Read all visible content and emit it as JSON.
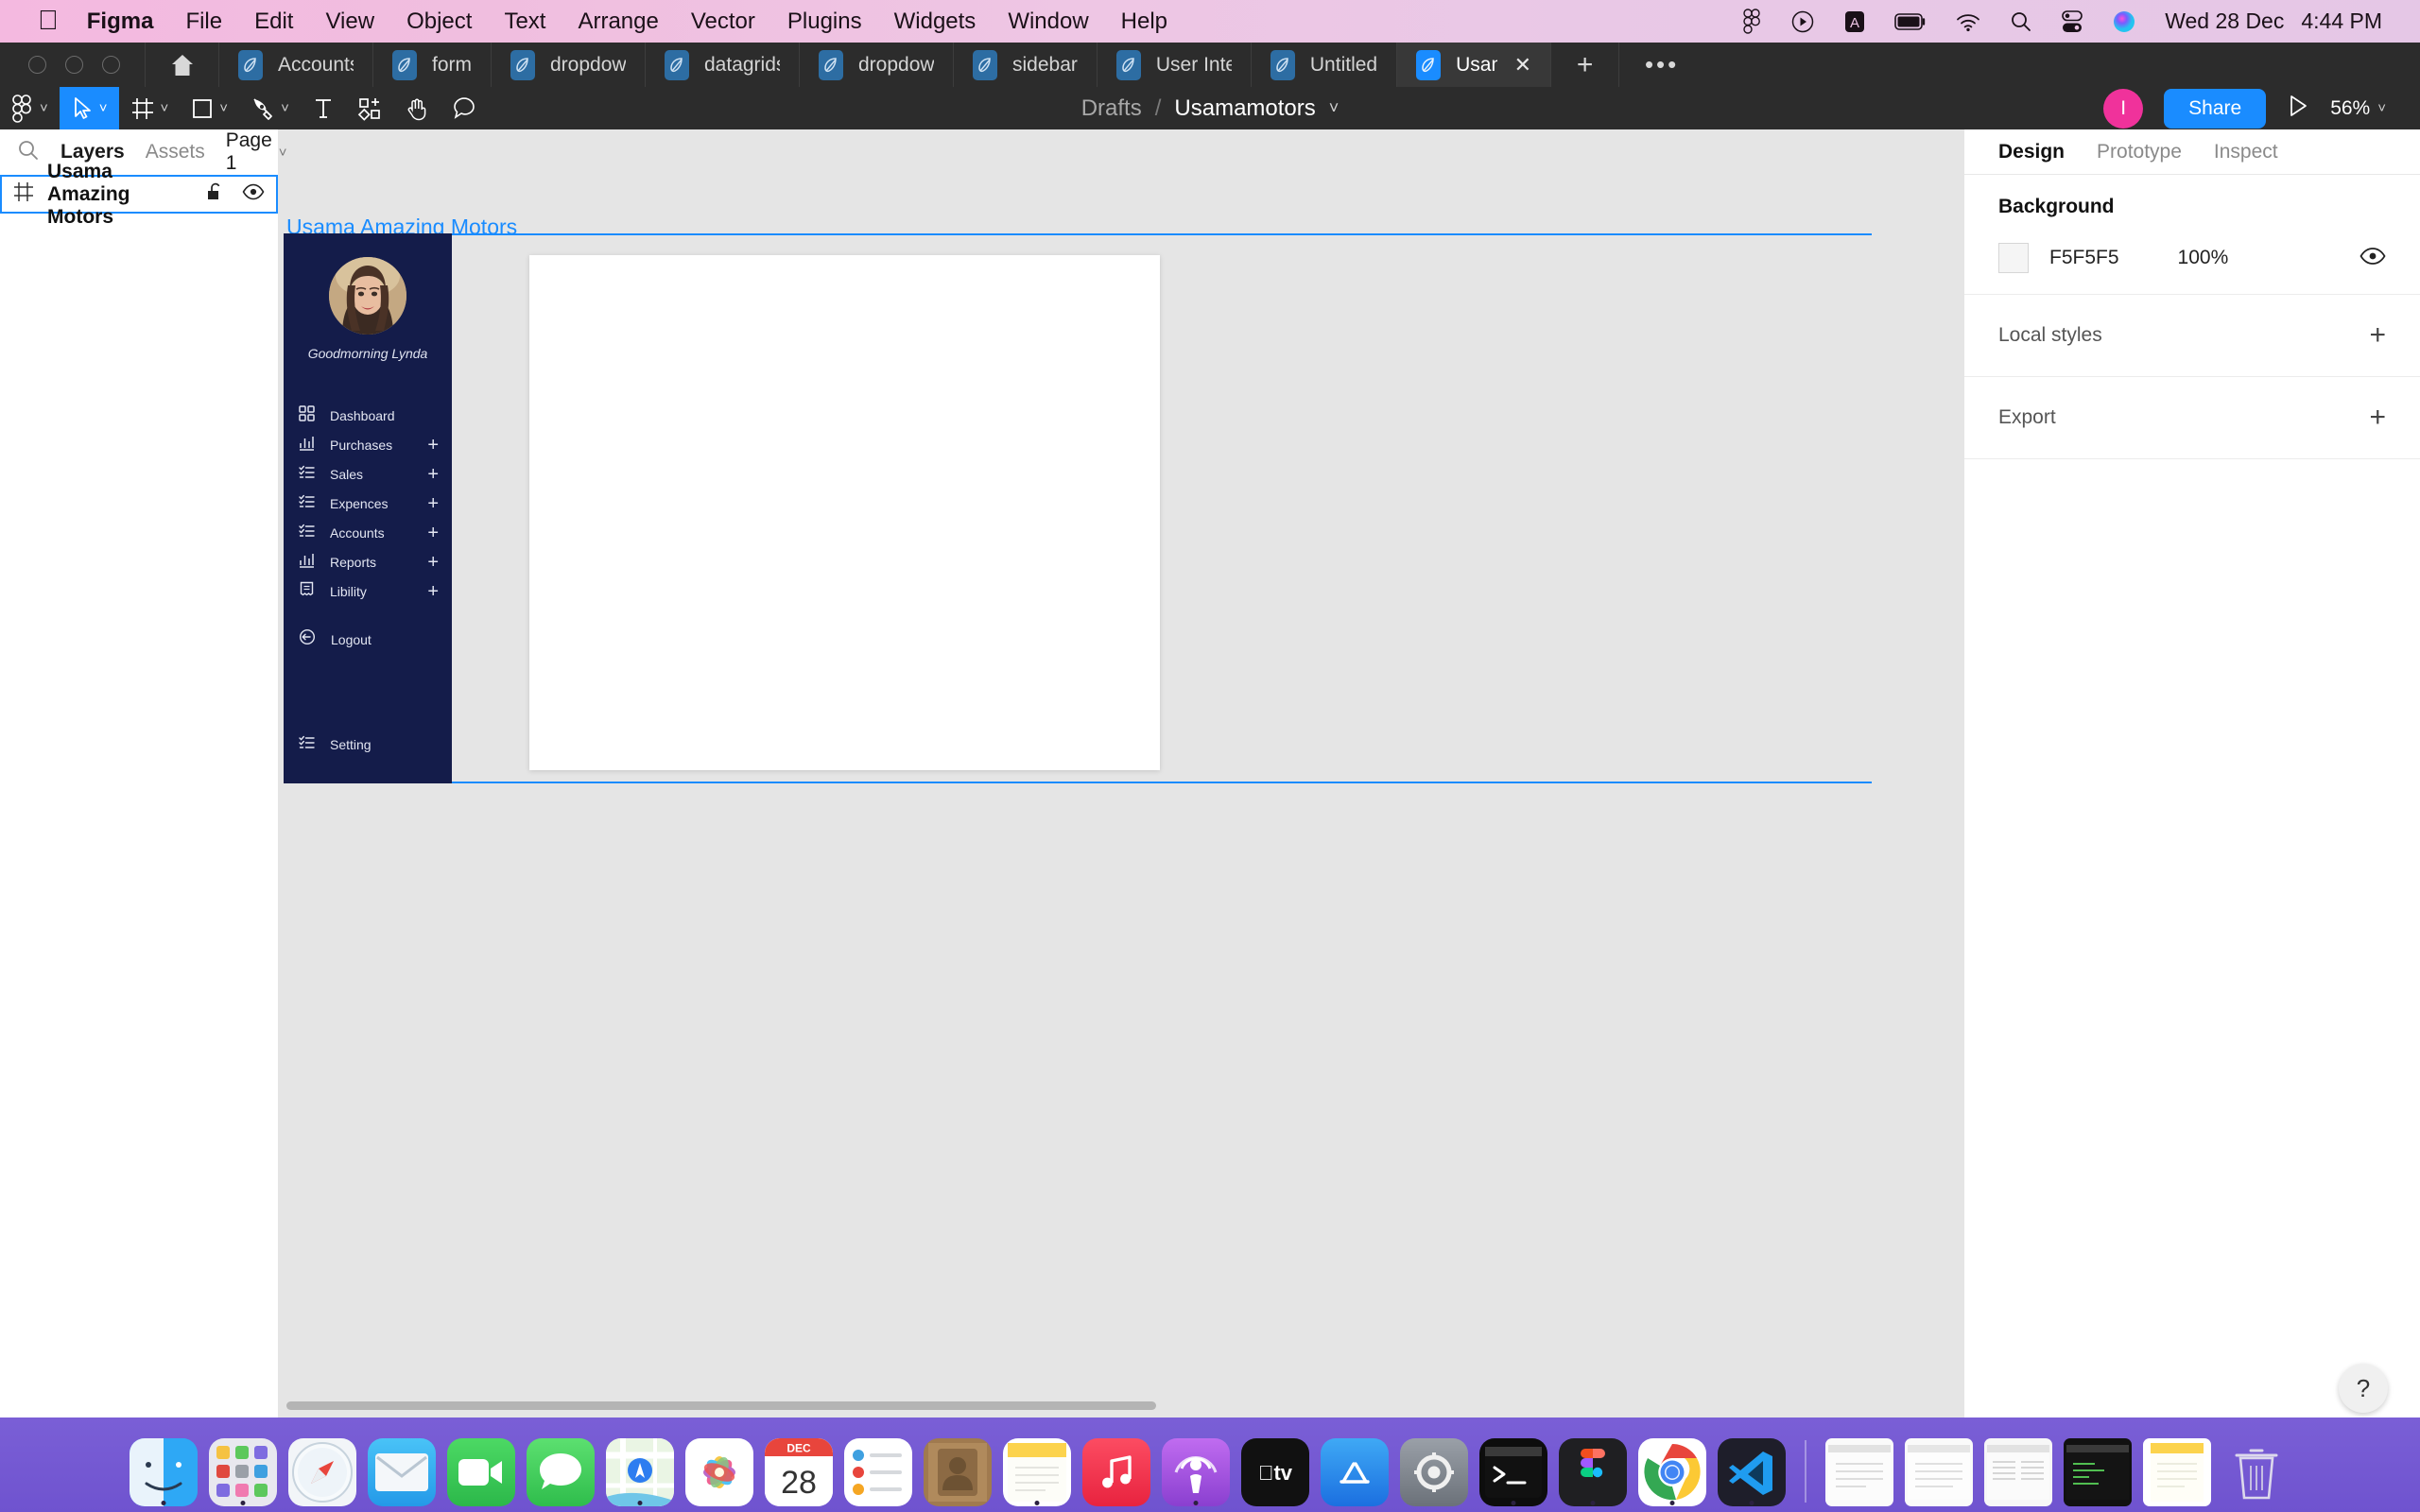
{
  "menubar": {
    "apple_icon": "apple-logo-icon",
    "items": [
      {
        "label": "Figma",
        "bold": true
      },
      {
        "label": "File",
        "bold": false
      },
      {
        "label": "Edit",
        "bold": false
      },
      {
        "label": "View",
        "bold": false
      },
      {
        "label": "Object",
        "bold": false
      },
      {
        "label": "Text",
        "bold": false
      },
      {
        "label": "Arrange",
        "bold": false
      },
      {
        "label": "Vector",
        "bold": false
      },
      {
        "label": "Plugins",
        "bold": false
      },
      {
        "label": "Widgets",
        "bold": false
      },
      {
        "label": "Window",
        "bold": false
      },
      {
        "label": "Help",
        "bold": false
      }
    ],
    "status_icons": [
      "figma-menu-icon",
      "playback-icon",
      "character-input-icon",
      "battery-icon",
      "wifi-icon",
      "search-icon",
      "control-center-icon",
      "siri-icon"
    ],
    "date": "Wed 28 Dec",
    "time": "4:44 PM",
    "background": "#edc4e4"
  },
  "tabs": {
    "home_icon": "home-icon",
    "items": [
      {
        "label": "Accounts",
        "active": false
      },
      {
        "label": "form",
        "active": false
      },
      {
        "label": "dropdownme",
        "active": false
      },
      {
        "label": "datagrids",
        "active": false
      },
      {
        "label": "dropdown lis",
        "active": false
      },
      {
        "label": "sidebar",
        "active": false
      },
      {
        "label": "User Interfac",
        "active": false
      },
      {
        "label": "Untitled",
        "active": false
      },
      {
        "label": "Usamamot",
        "active": true
      }
    ],
    "close_label": "✕",
    "new_tab_label": "+",
    "overflow_label": "•••"
  },
  "toolbar": {
    "tools": [
      {
        "name": "figma-menu-icon",
        "caret": true,
        "selected": false
      },
      {
        "name": "move-tool-icon",
        "caret": true,
        "selected": true
      },
      {
        "name": "frame-tool-icon",
        "caret": true,
        "selected": false
      },
      {
        "name": "shape-tool-icon",
        "caret": true,
        "selected": false
      },
      {
        "name": "pen-tool-icon",
        "caret": true,
        "selected": false
      },
      {
        "name": "text-tool-icon",
        "caret": false,
        "selected": false
      },
      {
        "name": "components-tool-icon",
        "caret": false,
        "selected": false
      },
      {
        "name": "hand-tool-icon",
        "caret": false,
        "selected": false
      },
      {
        "name": "comment-tool-icon",
        "caret": false,
        "selected": false
      }
    ],
    "breadcrumb_project": "Drafts",
    "breadcrumb_separator": "/",
    "breadcrumb_file": "Usamamotors",
    "avatar_initial": "I",
    "avatar_color": "#f0329b",
    "share_label": "Share",
    "present_icon": "present-play-icon",
    "zoom_level": "56%",
    "accent_color": "#1a8cff"
  },
  "left_panel": {
    "search_icon": "search-icon",
    "tabs": [
      {
        "label": "Layers",
        "active": true
      },
      {
        "label": "Assets",
        "active": false
      }
    ],
    "page_selector": "Page 1",
    "layers": [
      {
        "name": "Usama Amazing Motors",
        "icon": "frame-icon",
        "lock_icon": "unlock-icon",
        "visibility_icon": "eye-icon",
        "selected": true
      }
    ]
  },
  "canvas": {
    "frame_label": "Usama Amazing Motors",
    "background": "#e5e5e5",
    "sidebar": {
      "background": "#141c4a",
      "avatar_alt": "user-profile-photo",
      "greeting": "Goodmorning Lynda",
      "menu": [
        {
          "label": "Dashboard",
          "icon": "grid-dashboard-icon",
          "has_plus": false
        },
        {
          "label": "Purchases",
          "icon": "bar-chart-icon",
          "has_plus": true
        },
        {
          "label": "Sales",
          "icon": "checklist-icon",
          "has_plus": true
        },
        {
          "label": "Expences",
          "icon": "checklist-icon",
          "has_plus": true
        },
        {
          "label": "Accounts",
          "icon": "checklist-icon",
          "has_plus": true
        },
        {
          "label": "Reports",
          "icon": "bar-chart-icon",
          "has_plus": true
        },
        {
          "label": "Libility",
          "icon": "receipt-icon",
          "has_plus": true
        }
      ],
      "logout": {
        "label": "Logout",
        "icon": "logout-icon"
      },
      "setting": {
        "label": "Setting",
        "icon": "checklist-icon"
      },
      "plus_label": "+"
    }
  },
  "right_panel": {
    "tabs": [
      {
        "label": "Design",
        "active": true
      },
      {
        "label": "Prototype",
        "active": false
      },
      {
        "label": "Inspect",
        "active": false
      }
    ],
    "background_section": {
      "title": "Background",
      "color_hex": "F5F5F5",
      "opacity": "100%",
      "visibility_icon": "eye-icon"
    },
    "local_styles": {
      "label": "Local styles",
      "add_label": "+"
    },
    "export": {
      "label": "Export",
      "add_label": "+"
    },
    "help_label": "?"
  },
  "dock": {
    "items": [
      {
        "name": "finder-icon",
        "label": "Finder",
        "running": true
      },
      {
        "name": "launchpad-icon",
        "label": "Launchpad",
        "running": true
      },
      {
        "name": "safari-icon",
        "label": "Safari",
        "running": false
      },
      {
        "name": "mail-icon",
        "label": "Mail",
        "running": false
      },
      {
        "name": "facetime-icon",
        "label": "FaceTime",
        "running": false
      },
      {
        "name": "messages-icon",
        "label": "Messages",
        "running": false
      },
      {
        "name": "maps-icon",
        "label": "Maps",
        "running": true
      },
      {
        "name": "photos-icon",
        "label": "Photos",
        "running": false
      },
      {
        "name": "calendar-icon",
        "label": "Calendar",
        "running": false,
        "month": "DEC",
        "day": "28"
      },
      {
        "name": "reminders-icon",
        "label": "Reminders",
        "running": false
      },
      {
        "name": "contacts-icon",
        "label": "Contacts",
        "running": false
      },
      {
        "name": "notes-icon",
        "label": "Notes",
        "running": true
      },
      {
        "name": "music-icon",
        "label": "Music",
        "running": false
      },
      {
        "name": "podcasts-icon",
        "label": "Podcasts",
        "running": true
      },
      {
        "name": "appletv-icon",
        "label": "Apple TV",
        "running": false
      },
      {
        "name": "appstore-icon",
        "label": "App Store",
        "running": false
      },
      {
        "name": "settings-icon",
        "label": "System Settings",
        "running": false
      },
      {
        "name": "terminal-icon",
        "label": "Terminal",
        "running": true
      },
      {
        "name": "figma-app-icon",
        "label": "Figma",
        "running": true
      },
      {
        "name": "chrome-icon",
        "label": "Chrome",
        "running": true
      },
      {
        "name": "vscode-icon",
        "label": "Visual Studio Code",
        "running": true
      },
      {
        "name": "document-window-icon",
        "label": "Document",
        "running": false
      },
      {
        "name": "document-window-icon-2",
        "label": "Document",
        "running": false
      },
      {
        "name": "document-window-icon-3",
        "label": "Document",
        "running": false
      },
      {
        "name": "terminal-window-icon",
        "label": "Terminal Window",
        "running": false
      },
      {
        "name": "notes-window-icon",
        "label": "Notes Window",
        "running": false
      },
      {
        "name": "trash-icon",
        "label": "Trash",
        "running": false
      }
    ]
  }
}
